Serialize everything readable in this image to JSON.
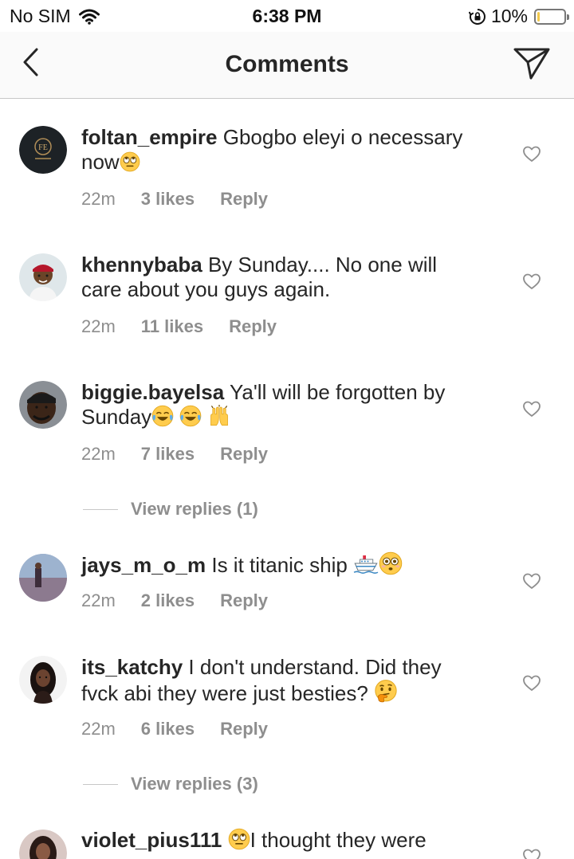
{
  "status_bar": {
    "carrier": "No SIM",
    "time": "6:38 PM",
    "battery_percent": "10%",
    "battery_level": 0.1,
    "wifi_icon": "wifi-icon",
    "lock_icon": "orientation-lock-icon"
  },
  "header": {
    "title": "Comments",
    "back_icon": "chevron-left-icon",
    "send_icon": "paper-plane-icon"
  },
  "comments": [
    {
      "username": "foltan_empire",
      "text_line1": "Gbogbo eleyi o necessary",
      "text_line2": "now",
      "emojis": [
        "face-with-rolling-eyes"
      ],
      "time": "22m",
      "likes": "3 likes",
      "reply": "Reply"
    },
    {
      "username": "khennybaba",
      "text_line1": "By Sunday.... No one will",
      "text_line2": "care about you guys again.",
      "time": "22m",
      "likes": "11 likes",
      "reply": "Reply"
    },
    {
      "username": "biggie.bayelsa",
      "text_line1": "Ya'll will be forgotten by",
      "text_line2": "Sunday",
      "emojis": [
        "face-with-tears-of-joy",
        "face-with-tears-of-joy",
        "raising-hands"
      ],
      "time": "22m",
      "likes": "7 likes",
      "reply": "Reply",
      "view_replies": "View replies (1)"
    },
    {
      "username": "jays_m_o_m",
      "text_line1": "Is it titanic ship",
      "emojis": [
        "ship",
        "flushed-face"
      ],
      "time": "22m",
      "likes": "2 likes",
      "reply": "Reply"
    },
    {
      "username": "its_katchy",
      "text_line1": "I don't understand. Did they",
      "text_line2": "fvck abi they were just besties?",
      "emojis": [
        "thinking-face"
      ],
      "time": "22m",
      "likes": "6 likes",
      "reply": "Reply",
      "view_replies": "View replies (3)"
    },
    {
      "username": "violet_pius111",
      "text_line1": "I thought they were",
      "emojis": [
        "face-with-rolling-eyes"
      ]
    }
  ],
  "colors": {
    "text": "#262626",
    "meta": "#8e8e8e",
    "header_bg": "#fafafa",
    "battery": "#f2c94c"
  }
}
